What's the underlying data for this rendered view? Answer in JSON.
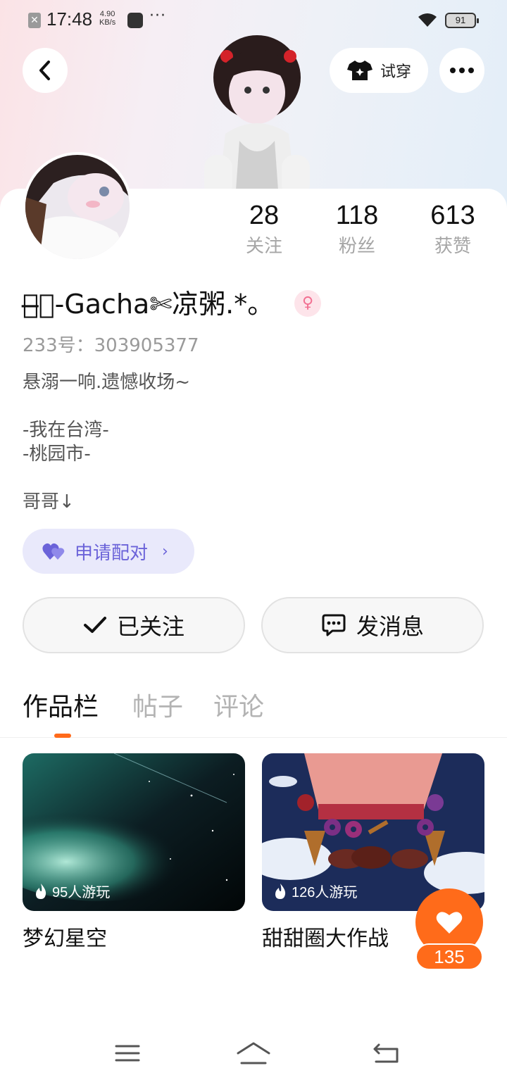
{
  "status_bar": {
    "time": "17:48",
    "speed_value": "4.90",
    "speed_unit": "KB/s",
    "more": "···",
    "battery": "91"
  },
  "header": {
    "tryon_label": "试穿"
  },
  "profile": {
    "stats": [
      {
        "value": "28",
        "label": "关注"
      },
      {
        "value": "118",
        "label": "粉丝"
      },
      {
        "value": "613",
        "label": "获赞"
      }
    ],
    "nickname": "ꫂ̶͙-Gacha✄凉粥.*。",
    "gender_symbol": "♀",
    "uid": "233号：303905377",
    "bio": "悬溺一响.遗憾收场~\n\n-我在台湾-\n-桃园市-\n\n哥哥↓",
    "pair_label": "申请配对"
  },
  "actions": {
    "follow_label": "已关注",
    "message_label": "发消息"
  },
  "tabs": [
    {
      "label": "作品栏",
      "active": true
    },
    {
      "label": "帖子",
      "active": false
    },
    {
      "label": "评论",
      "active": false
    }
  ],
  "works": [
    {
      "title": "梦幻星空",
      "plays": "95人游玩"
    },
    {
      "title": "甜甜圈大作战",
      "plays": "126人游玩"
    }
  ],
  "like_count": "135",
  "colors": {
    "accent_orange": "#ff6b1a",
    "pair_purple": "#6b63d9",
    "pair_bg": "#e9e9fb",
    "gender_pink": "#f26f91"
  }
}
